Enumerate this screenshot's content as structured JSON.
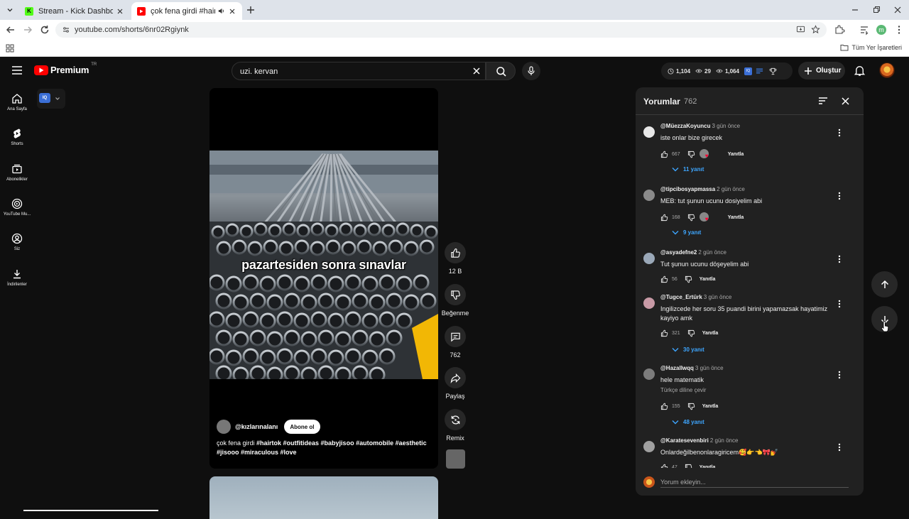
{
  "browser": {
    "tabs": [
      {
        "title": "Stream - Kick Dashboard",
        "favicon_color": "#53fc18"
      },
      {
        "title": "çok fena girdi #hairtok #ou",
        "favicon_color": "#ff0000"
      }
    ],
    "url": "youtube.com/shorts/6nr02Rgiynk",
    "profile_initial": "m",
    "all_bookmarks": "Tüm Yer İşaretleri"
  },
  "header": {
    "logo": "Premium",
    "country": "TR",
    "search_value": "uzi. kervan",
    "stats": {
      "watch": "1,104",
      "views": "29",
      "eye2": "1,064"
    },
    "create": "Oluştur"
  },
  "sidebar": {
    "items": [
      {
        "label": "Ana Sayfa",
        "icon": "home-icon"
      },
      {
        "label": "Shorts",
        "icon": "shorts-icon"
      },
      {
        "label": "Abonelikler",
        "icon": "subscriptions-icon"
      },
      {
        "label": "YouTube Mu...",
        "icon": "music-icon"
      },
      {
        "label": "Siz",
        "icon": "you-icon"
      },
      {
        "label": "İndirilenler",
        "icon": "download-icon"
      }
    ],
    "iq_badge": "IQ"
  },
  "short": {
    "overlay_text": "pazartesiden sonra sınavlar",
    "channel": "@kızlarınalanı",
    "subscribe": "Abone ol",
    "description_plain": "çok fena girdi ",
    "description_tags": "#hairtok #outfitideas #babyjisoo #automobile #aesthetic #jisooo #miraculous #love",
    "likes": "12 B",
    "dislike_label": "Beğenme",
    "comments": "762",
    "share_label": "Paylaş",
    "remix_label": "Remix"
  },
  "comments_panel": {
    "title": "Yorumlar",
    "count": "762",
    "reply_label": "Yanıtla",
    "add_placeholder": "Yorum ekleyin...",
    "items": [
      {
        "user": "@MüezzaKoyuncu",
        "time": "3 gün önce",
        "text": "iste onlar bize girecek",
        "likes": "667",
        "replies": "11 yanıt",
        "creator_heart": true,
        "avatar_color": "#e8e8e8"
      },
      {
        "user": "@tipcibosyapmassa",
        "time": "2 gün önce",
        "text": "MEB: tut şunun ucunu dosiyelim abi",
        "likes": "168",
        "replies": "9 yanıt",
        "creator_heart": true,
        "avatar_color": "#8a8a8a"
      },
      {
        "user": "@asyadefne2",
        "time": "2 gün önce",
        "text": "Tut şunun ucunu döşeyelim abi",
        "likes": "56",
        "replies": "",
        "creator_heart": false,
        "avatar_color": "#9aa8b8"
      },
      {
        "user": "@Tugce_Ertürk",
        "time": "3 gün önce",
        "text": "Ingilizcede her soru 35 puandi birini yapamazsak hayatimiz kayiyo amk",
        "likes": "321",
        "replies": "30 yanıt",
        "creator_heart": false,
        "avatar_color": "#c89aa6"
      },
      {
        "user": "@Hazallwqq",
        "time": "3 gün önce",
        "text": "hele matematik",
        "translate": "Türkçe diline çevir",
        "likes": "155",
        "replies": "48 yanıt",
        "creator_heart": false,
        "avatar_color": "#7c7c7c"
      },
      {
        "user": "@Karatesevenbiri",
        "time": "2 gün önce",
        "text": "Onlardeğilbenonlaragiricem🥰👉👈🎀💅",
        "likes": "47",
        "replies": "",
        "creator_heart": false,
        "avatar_color": "#a0a0a0"
      }
    ]
  }
}
